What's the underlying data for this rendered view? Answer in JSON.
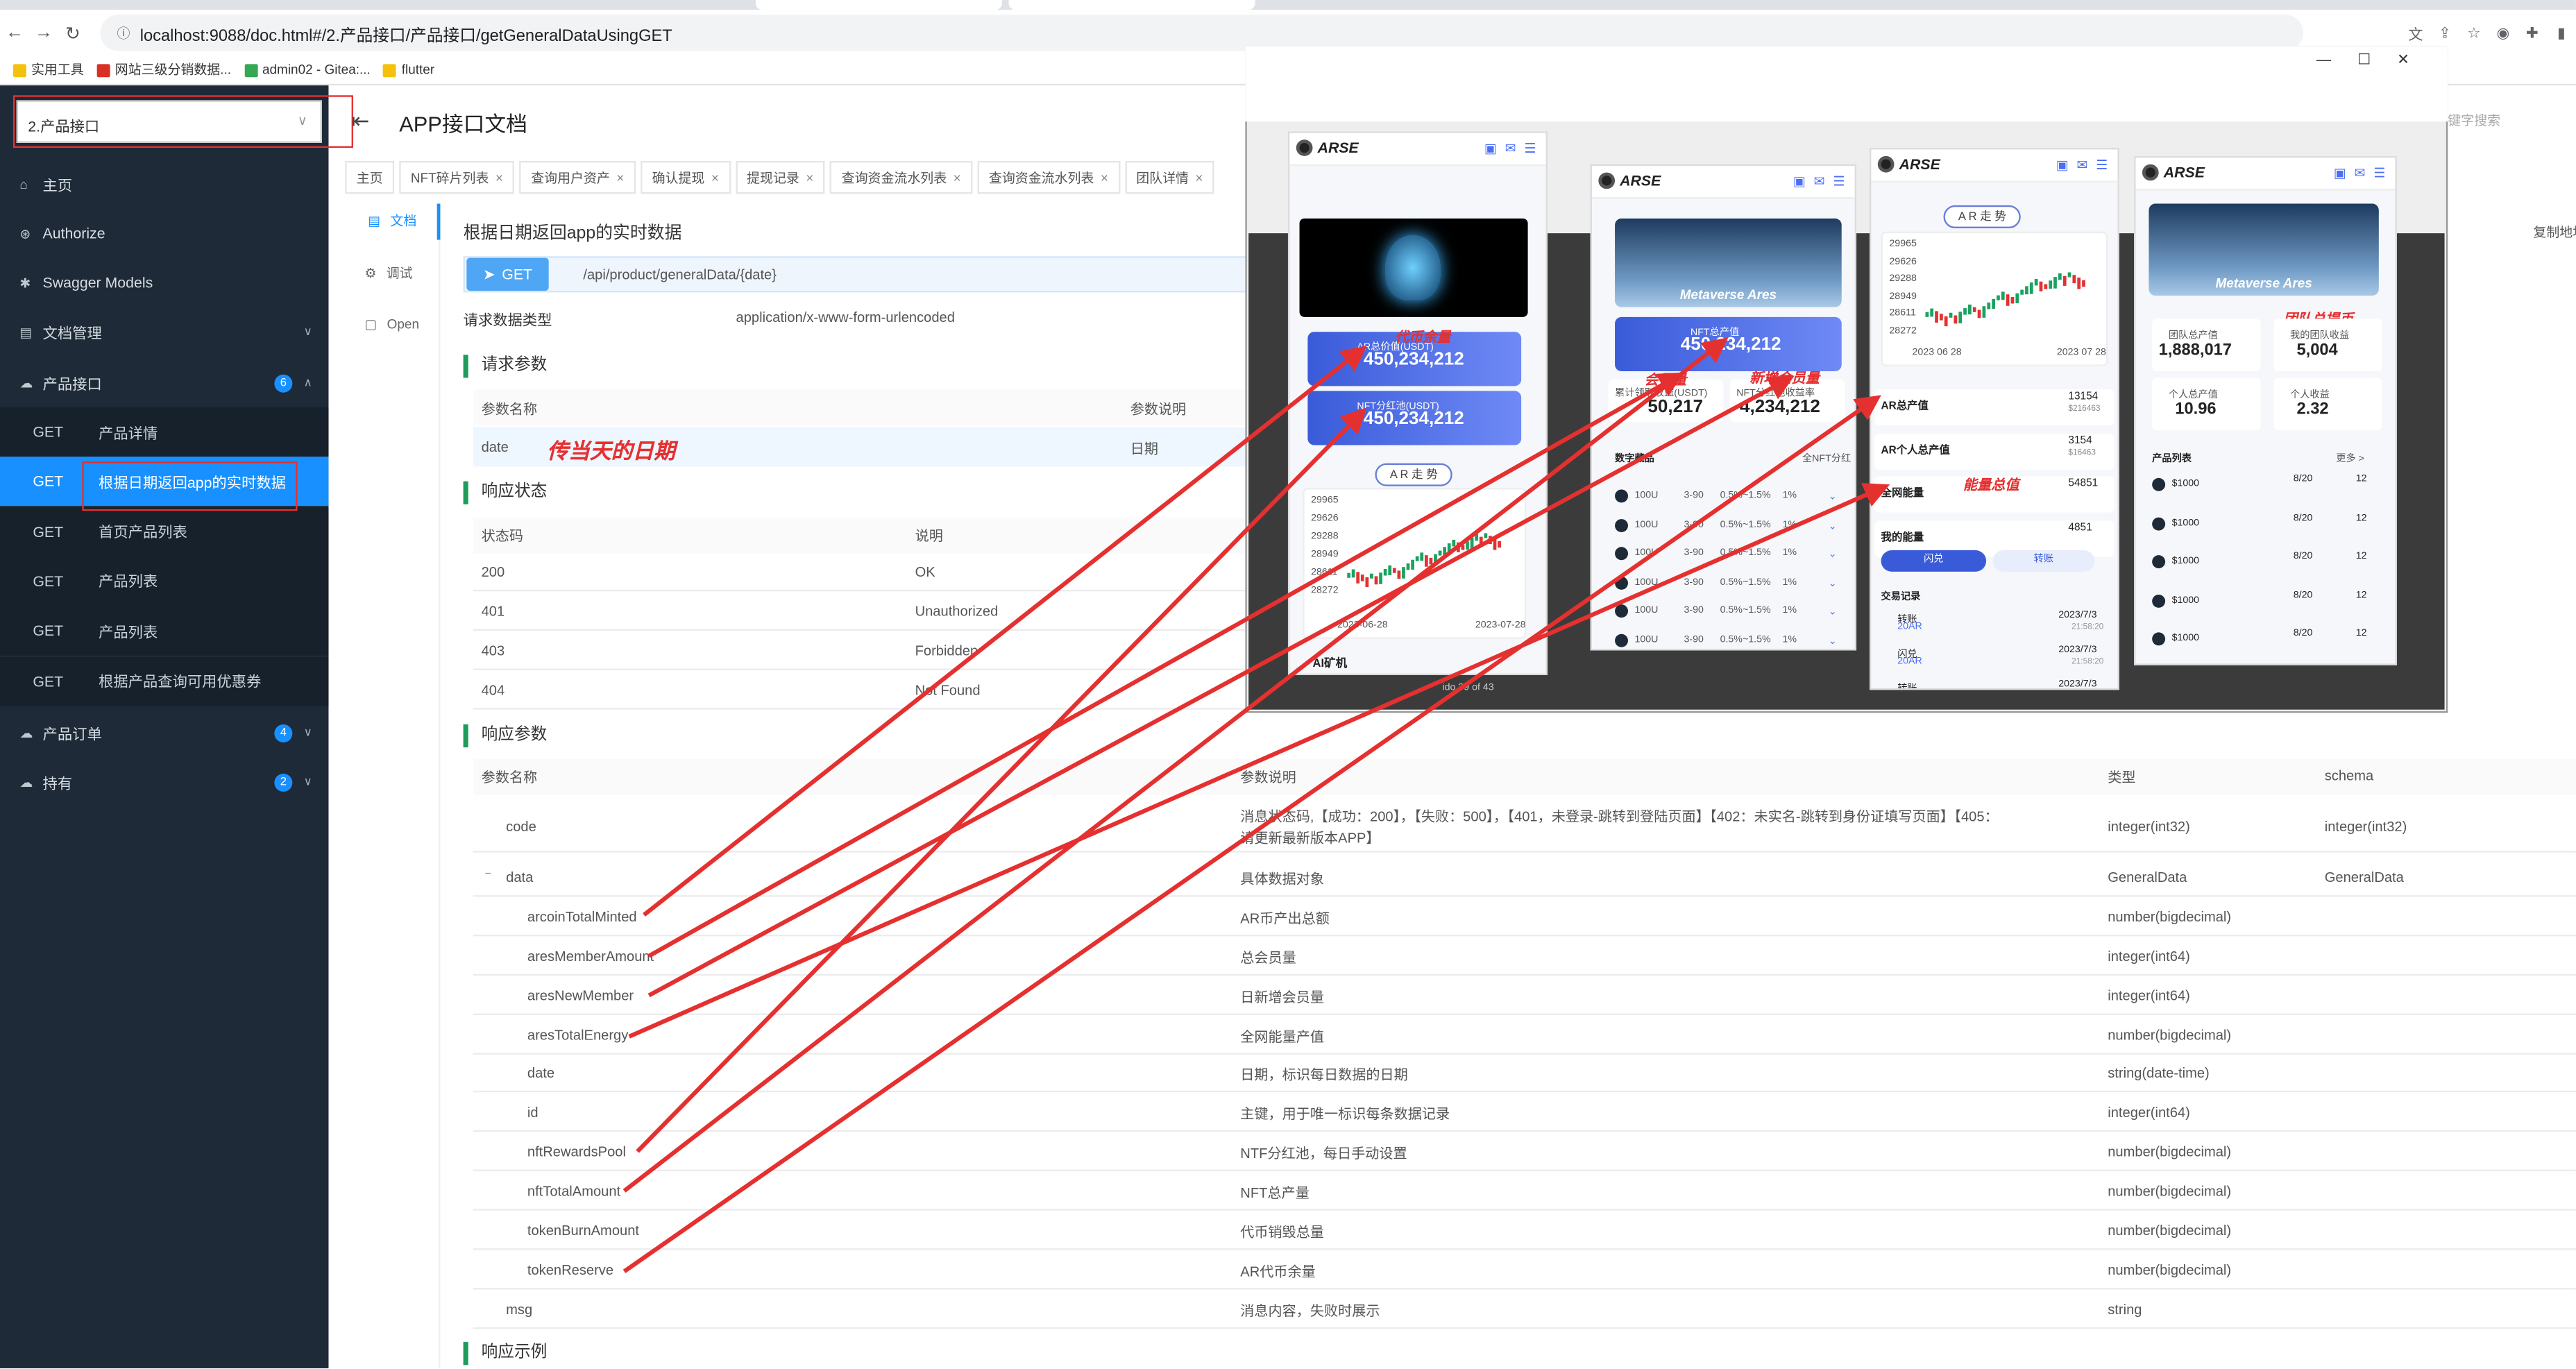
{
  "browser": {
    "url": "localhost:9088/doc.html#/2.产品接口/产品接口/getGeneralDataUsingGET",
    "bookmarks": [
      {
        "label": "实用工具",
        "color": "#f4c20d"
      },
      {
        "label": "网站三级分销数据...",
        "color": "#d93025"
      },
      {
        "label": "admin02 - Gitea:...",
        "color": "#34a853"
      },
      {
        "label": "flutter",
        "color": "#f4c20d"
      }
    ]
  },
  "sidebar": {
    "group_select": "2.产品接口",
    "menu": [
      {
        "label": "主页",
        "icon": "home-icon",
        "glyph": "⌂"
      },
      {
        "label": "Authorize",
        "icon": "authorize-icon",
        "glyph": "⊛"
      },
      {
        "label": "Swagger Models",
        "icon": "models-icon",
        "glyph": "✱"
      },
      {
        "label": "文档管理",
        "icon": "docs-icon",
        "glyph": "▤"
      }
    ],
    "product_group": {
      "label": "产品接口",
      "count": "6"
    },
    "product_items": [
      {
        "method": "GET",
        "label": "产品详情"
      },
      {
        "method": "GET",
        "label": "根据日期返回app的实时数据"
      },
      {
        "method": "GET",
        "label": "首页产品列表"
      },
      {
        "method": "GET",
        "label": "产品列表"
      },
      {
        "method": "GET",
        "label": "产品列表"
      },
      {
        "method": "GET",
        "label": "根据产品查询可用优惠券"
      }
    ],
    "order_group": {
      "label": "产品订单",
      "count": "4"
    },
    "hold_group": {
      "label": "持有",
      "count": "2"
    }
  },
  "header": {
    "title": "APP接口文档"
  },
  "tabs": [
    {
      "label": "主页"
    },
    {
      "label": "NFT碎片列表"
    },
    {
      "label": "查询用户资产"
    },
    {
      "label": "确认提现"
    },
    {
      "label": "提现记录"
    },
    {
      "label": "查询资金流水列表"
    },
    {
      "label": "查询资金流水列表"
    },
    {
      "label": "团队详情"
    }
  ],
  "left_nav": [
    {
      "label": "文档"
    },
    {
      "label": "调试"
    },
    {
      "label": "Open"
    }
  ],
  "doc": {
    "title": "根据日期返回app的实时数据",
    "method": "GET",
    "path": "/api/product/generalData/{date}",
    "req_type_label": "请求数据类型",
    "req_type": "application/x-www-form-urlencoded",
    "req_params_title": "请求参数",
    "req_cols": [
      "参数名称",
      "参数说明"
    ],
    "req_row": {
      "name": "date",
      "desc": "日期"
    },
    "req_note": "传当天的日期",
    "resp_status_title": "响应状态",
    "status_cols": [
      "状态码",
      "说明"
    ],
    "statuses": [
      {
        "code": "200",
        "desc": "OK"
      },
      {
        "code": "401",
        "desc": "Unauthorized"
      },
      {
        "code": "403",
        "desc": "Forbidden"
      },
      {
        "code": "404",
        "desc": "Not Found"
      }
    ],
    "resp_params_title": "响应参数",
    "resp_cols": [
      "参数名称",
      "参数说明",
      "类型",
      "schema"
    ],
    "resp_rows": [
      {
        "name": "code",
        "desc": "消息状态码,【成功：200】，【失败：500】，【401，未登录-跳转到登陆页面】【402：未实名-跳转到身份证填写页面】【405：",
        "desc2": "请更新最新版本APP】",
        "type": "integer(int32)",
        "schema": "integer(int32)"
      },
      {
        "name": "data",
        "desc": "具体数据对象",
        "type": "GeneralData",
        "schema": "GeneralData"
      },
      {
        "name": "arcoinTotalMinted",
        "desc": "AR币产出总额",
        "type": "number(bigdecimal)",
        "schema": ""
      },
      {
        "name": "aresMemberAmount",
        "desc": "总会员量",
        "type": "integer(int64)",
        "schema": ""
      },
      {
        "name": "aresNewMember",
        "desc": "日新增会员量",
        "type": "integer(int64)",
        "schema": ""
      },
      {
        "name": "aresTotalEnergy",
        "desc": "全网能量产值",
        "type": "number(bigdecimal)",
        "schema": ""
      },
      {
        "name": "date",
        "desc": "日期，标识每日数据的日期",
        "type": "string(date-time)",
        "schema": ""
      },
      {
        "name": "id",
        "desc": "主键，用于唯一标识每条数据记录",
        "type": "integer(int64)",
        "schema": ""
      },
      {
        "name": "nftRewardsPool",
        "desc": "NTF分红池，每日手动设置",
        "type": "number(bigdecimal)",
        "schema": ""
      },
      {
        "name": "nftTotalAmount",
        "desc": "NFT总产量",
        "type": "number(bigdecimal)",
        "schema": ""
      },
      {
        "name": "tokenBurnAmount",
        "desc": "代币销毁总量",
        "type": "number(bigdecimal)",
        "schema": ""
      },
      {
        "name": "tokenReserve",
        "desc": "AR代币余量",
        "type": "number(bigdecimal)",
        "schema": ""
      },
      {
        "name": "msg",
        "desc": "消息内容，失败时展示",
        "type": "string",
        "schema": ""
      }
    ],
    "resp_example_title": "响应示例",
    "right_copy": "复制地址",
    "search_placeholder": "键字搜索"
  },
  "phones": {
    "brand": "ARSE",
    "p1": {
      "card1_label": "AR总价值(USDT)",
      "card1_value": "450,234,212",
      "card2_label": "NFT分红池(USDT)",
      "card2_value": "450,234,212",
      "pill": "A R 走 势",
      "ticks": [
        "29965",
        "29626",
        "29288",
        "28949",
        "28611",
        "28272"
      ],
      "d1": "2023-06-28",
      "d2": "2023-07-28",
      "footer": "AI矿机",
      "note1": "代币余量",
      "pager": "ido 39 of 43"
    },
    "p2": {
      "banner": "Metaverse Ares",
      "card_label": "NFT总产值",
      "card_value": "450,234,212",
      "m1_label": "累计领取收益(USDT)",
      "m1_value": "50,217",
      "m2_label": "NFT分红池收益率",
      "m2_value": "4,234,212",
      "note_member": "会员量",
      "note_new": "新增会员量",
      "list_title": "数字藏品",
      "list_more": "全NFT分红",
      "rows": [
        {
          "a": "100U",
          "b": "3-90",
          "c": "0.5%~1.5%",
          "d": "1%"
        },
        {
          "a": "100U",
          "b": "3-90",
          "c": "0.5%~1.5%",
          "d": "1%"
        },
        {
          "a": "100U",
          "b": "3-90",
          "c": "0.5%~1.5%",
          "d": "1%"
        },
        {
          "a": "100U",
          "b": "3-90",
          "c": "0.5%~1.5%",
          "d": "1%"
        },
        {
          "a": "100U",
          "b": "3-90",
          "c": "0.5%~1.5%",
          "d": "1%"
        },
        {
          "a": "100U",
          "b": "3-90",
          "c": "0.5%~1.5%",
          "d": "1%"
        }
      ]
    },
    "p3": {
      "pill": "A R 走 势",
      "ticks": [
        "29965",
        "29626",
        "29288",
        "28949",
        "28611",
        "28272"
      ],
      "d1": "2023 06 28",
      "d2": "2023 07 28",
      "rows": [
        {
          "label": "AR总产值",
          "v": "13154",
          "s": "$216463"
        },
        {
          "label": "AR个人总产值",
          "v": "3154",
          "s": "$16463"
        },
        {
          "label": "全网能量",
          "v": "54851",
          "s": ""
        },
        {
          "label": "我的能量",
          "v": "4851",
          "s": ""
        }
      ],
      "note_energy": "能量总值",
      "btn1": "闪兑",
      "btn2": "转账",
      "rec_title": "交易记录",
      "recs": [
        {
          "t": "转账",
          "a": "20AR",
          "d": "2023/7/3",
          "h": "21:58:20"
        },
        {
          "t": "闪兑",
          "a": "20AR",
          "d": "2023/7/3",
          "h": "21:58:20"
        },
        {
          "t": "转账",
          "a": "",
          "d": "2023/7/3",
          "h": ""
        }
      ]
    },
    "p4": {
      "banner": "Metaverse Ares",
      "note_team": "团队总提币",
      "s1_label": "团队总产值",
      "s1_value": "1,888,017",
      "s2_label": "我的团队收益",
      "s2_value": "5,004",
      "s3_label": "个人总产值",
      "s3_value": "10.96",
      "s4_label": "个人收益",
      "s4_value": "2.32",
      "list_title": "产品列表",
      "list_more": "更多 >",
      "items": [
        {
          "p": "$1000",
          "d": "8/20",
          "n": "12"
        },
        {
          "p": "$1000",
          "d": "8/20",
          "n": "12"
        },
        {
          "p": "$1000",
          "d": "8/20",
          "n": "12"
        },
        {
          "p": "$1000",
          "d": "8/20",
          "n": "12"
        },
        {
          "p": "$1000",
          "d": "8/20",
          "n": "12"
        }
      ]
    }
  },
  "colors": {
    "accent": "#1890ff",
    "annotation": "#e53030",
    "sidebar": "#1e2a37"
  }
}
